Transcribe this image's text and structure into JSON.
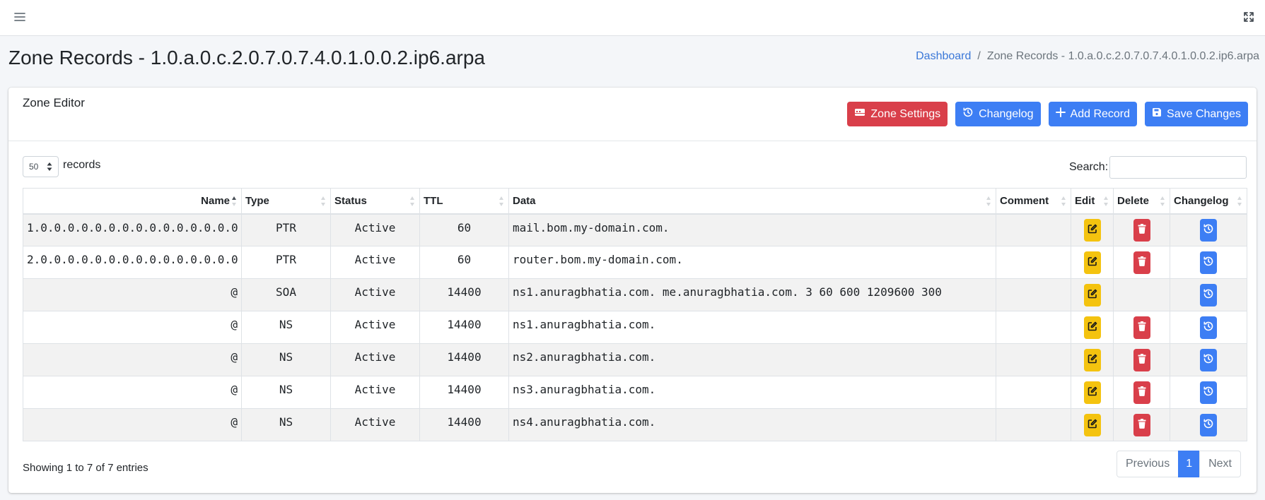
{
  "navbar": {
    "menu_icon": "hamburger-icon",
    "fullscreen_icon": "expand-icon"
  },
  "header": {
    "title": "Zone Records - 1.0.a.0.c.2.0.7.0.7.4.0.1.0.0.2.ip6.arpa",
    "breadcrumb": {
      "home": "Dashboard",
      "separator": "/",
      "current": "Zone Records - 1.0.a.0.c.2.0.7.0.7.4.0.1.0.0.2.ip6.arpa"
    }
  },
  "card": {
    "title": "Zone Editor",
    "buttons": {
      "zone_settings": "Zone Settings",
      "changelog": "Changelog",
      "add_record": "Add Record",
      "save_changes": "Save Changes"
    }
  },
  "table_controls": {
    "page_length": "50",
    "page_length_suffix": "records",
    "search_label": "Search:",
    "search_value": ""
  },
  "table": {
    "columns": [
      "Name",
      "Type",
      "Status",
      "TTL",
      "Data",
      "Comment",
      "Edit",
      "Delete",
      "Changelog"
    ],
    "rows": [
      {
        "name": "1.0.0.0.0.0.0.0.0.0.0.0.0.0.0.0",
        "type": "PTR",
        "status": "Active",
        "ttl": "60",
        "data": "mail.bom.my-domain.com.",
        "comment": "",
        "deletable": true
      },
      {
        "name": "2.0.0.0.0.0.0.0.0.0.0.0.0.0.0.0",
        "type": "PTR",
        "status": "Active",
        "ttl": "60",
        "data": "router.bom.my-domain.com.",
        "comment": "",
        "deletable": true
      },
      {
        "name": "@",
        "type": "SOA",
        "status": "Active",
        "ttl": "14400",
        "data": "ns1.anuragbhatia.com. me.anuragbhatia.com. 3 60 600 1209600 300",
        "comment": "",
        "deletable": false
      },
      {
        "name": "@",
        "type": "NS",
        "status": "Active",
        "ttl": "14400",
        "data": "ns1.anuragbhatia.com.",
        "comment": "",
        "deletable": true
      },
      {
        "name": "@",
        "type": "NS",
        "status": "Active",
        "ttl": "14400",
        "data": "ns2.anuragbhatia.com.",
        "comment": "",
        "deletable": true
      },
      {
        "name": "@",
        "type": "NS",
        "status": "Active",
        "ttl": "14400",
        "data": "ns3.anuragbhatia.com.",
        "comment": "",
        "deletable": true
      },
      {
        "name": "@",
        "type": "NS",
        "status": "Active",
        "ttl": "14400",
        "data": "ns4.anuragbhatia.com.",
        "comment": "",
        "deletable": true
      }
    ]
  },
  "footer": {
    "info": "Showing 1 to 7 of 7 entries",
    "pagination": {
      "previous": "Previous",
      "current": "1",
      "next": "Next"
    }
  },
  "colors": {
    "primary": "#3d7ef4",
    "danger": "#d93f4a",
    "warning": "#f4c30f",
    "link": "#3b78d8",
    "page_bg": "#f4f6f9"
  }
}
